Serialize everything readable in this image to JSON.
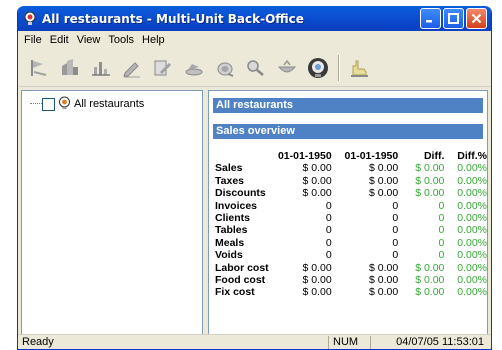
{
  "window": {
    "title": "All restaurants - Multi-Unit Back-Office"
  },
  "menu": [
    "File",
    "Edit",
    "View",
    "Tools",
    "Help"
  ],
  "toolbar": {
    "icons": [
      "flag-icon",
      "building-icon",
      "chart-icon",
      "pencil-icon",
      "edit-document-icon",
      "dishes-icon",
      "scale-icon",
      "search-icon",
      "bowl-icon",
      "globe-icon",
      "hand-icon"
    ]
  },
  "tree": {
    "root_label": "All restaurants"
  },
  "panel": {
    "header": "All restaurants",
    "section": "Sales overview",
    "columns": [
      "",
      "01-01-1950",
      "01-01-1950",
      "Diff.",
      "Diff.%"
    ],
    "rows": [
      {
        "label": "Sales",
        "d1": "$ 0.00",
        "d2": "$ 0.00",
        "diff": "$ 0.00",
        "pct": "0.00%"
      },
      {
        "label": "Taxes",
        "d1": "$ 0.00",
        "d2": "$ 0.00",
        "diff": "$ 0.00",
        "pct": "0.00%"
      },
      {
        "label": "Discounts",
        "d1": "$ 0.00",
        "d2": "$ 0.00",
        "diff": "$ 0.00",
        "pct": "0.00%"
      },
      {
        "label": "Invoices",
        "d1": "0",
        "d2": "0",
        "diff": "0",
        "pct": "0.00%"
      },
      {
        "label": "Clients",
        "d1": "0",
        "d2": "0",
        "diff": "0",
        "pct": "0.00%"
      },
      {
        "label": "Tables",
        "d1": "0",
        "d2": "0",
        "diff": "0",
        "pct": "0.00%"
      },
      {
        "label": "Meals",
        "d1": "0",
        "d2": "0",
        "diff": "0",
        "pct": "0.00%"
      },
      {
        "label": "Voids",
        "d1": "0",
        "d2": "0",
        "diff": "0",
        "pct": "0.00%"
      },
      {
        "label": "Labor cost",
        "d1": "$ 0.00",
        "d2": "$ 0.00",
        "diff": "$ 0.00",
        "pct": "0.00%"
      },
      {
        "label": "Food cost",
        "d1": "$ 0.00",
        "d2": "$ 0.00",
        "diff": "$ 0.00",
        "pct": "0.00%"
      },
      {
        "label": "Fix cost",
        "d1": "$ 0.00",
        "d2": "$ 0.00",
        "diff": "$ 0.00",
        "pct": "0.00%"
      }
    ]
  },
  "status": {
    "ready": "Ready",
    "num": "NUM",
    "datetime": "04/07/05  11:53:01"
  },
  "colors": {
    "title_bar": "#0b4ed1",
    "section_band": "#4f82c4",
    "diff_green": "#38a838"
  }
}
